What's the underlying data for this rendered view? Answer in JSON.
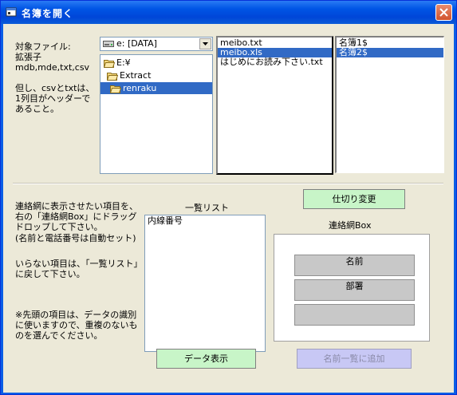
{
  "window": {
    "title": "名簿を開く",
    "icon": "form-icon",
    "close_icon": "close-icon"
  },
  "file_panel": {
    "label_text": "対象ファイル:\n拡張子\nmdb,mde,txt,csv\n\n但し、csvとtxtは、\n1列目がヘッダーで\nあること。",
    "drive": {
      "selected": "e: [DATA]",
      "icon": "drive-icon"
    },
    "folders": [
      {
        "label": "E:¥",
        "icon": "folder-open-icon"
      },
      {
        "label": "Extract",
        "icon": "folder-open-icon"
      },
      {
        "label": "renraku",
        "icon": "folder-open-icon",
        "selected": true
      }
    ],
    "files": [
      {
        "label": "meibo.txt",
        "selected": false
      },
      {
        "label": "meibo.xls",
        "selected": true
      },
      {
        "label": "はじめにお読み下さい.txt",
        "selected": false
      }
    ],
    "sheets": [
      {
        "label": "名簿1$",
        "selected": false
      },
      {
        "label": "名簿2$",
        "selected": true
      }
    ]
  },
  "instructions": {
    "text1": "連絡網に表示させたい項目を、右の「連絡網Box」にドラッグドロップして下さい。",
    "text2": "(名前と電話番号は自動セット)",
    "text3": "いらない項目は、「一覧リスト」に戻して下さい。",
    "text4": "※先頭の項目は、データの識別に使いますので、重複のないものを選んでください。"
  },
  "list": {
    "label": "一覧リスト",
    "items": [
      {
        "label": "内線番号"
      }
    ]
  },
  "contact_box": {
    "label": "連絡網Box",
    "slots": [
      {
        "label": "名前"
      },
      {
        "label": "部署"
      },
      {
        "label": ""
      }
    ]
  },
  "buttons": {
    "delimiter": "仕切り変更",
    "show_data": "データ表示",
    "add_name": "名前一覧に追加"
  },
  "colors": {
    "title_bar": "#0055e5",
    "window_bg": "#ece9d8",
    "selection": "#316ac5",
    "green_button": "#c8f5c8",
    "disabled_button": "#c8c8f5",
    "slot": "#c8c8c8"
  }
}
